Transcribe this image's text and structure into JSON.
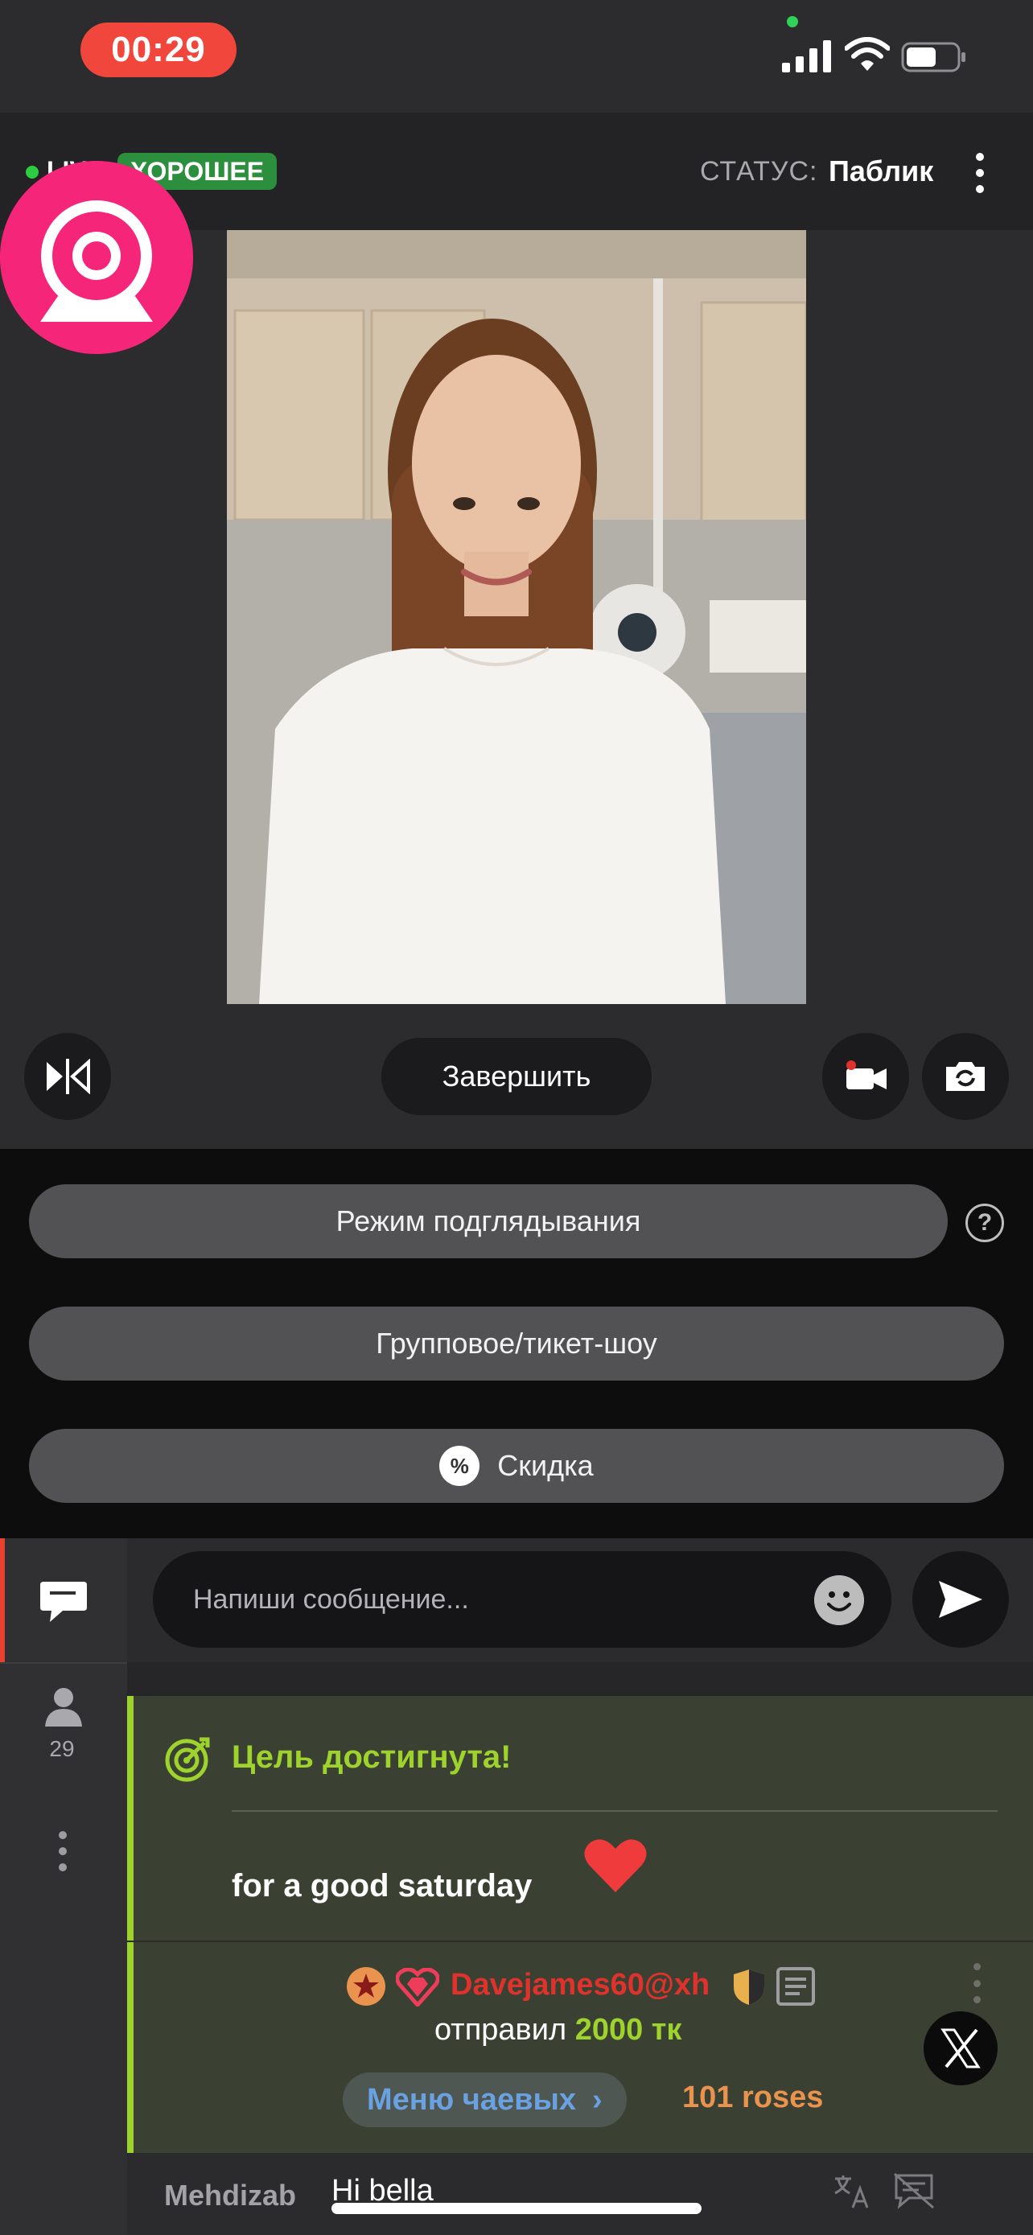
{
  "status_bar": {
    "time": "00:29"
  },
  "header": {
    "live_label": "LIVE",
    "quality_badge": "ХОРОШЕЕ",
    "status_label": "СТАТУС:",
    "status_value": "Паблик"
  },
  "controls": {
    "end_button": "Завершить"
  },
  "options": {
    "peek_mode": "Режим подглядывания",
    "group_show": "Групповое/тикет-шоу",
    "discount": "Скидка",
    "help": "?"
  },
  "chat": {
    "users_count": "29",
    "input_placeholder": "Напиши сообщение...",
    "goal": {
      "title": "Цель достигнута!",
      "text": "for a good saturday"
    },
    "tip": {
      "username": "Davejames60@xh",
      "sent_prefix": "отправил",
      "amount": "2000 тк",
      "menu_button": "Меню чаевых",
      "item": "101 roses"
    },
    "message": {
      "username": "Mehdizab",
      "text": "Hi bella"
    }
  },
  "colors": {
    "accent_green": "#9ed22c",
    "badge_green": "#2c8f3e",
    "live_red": "#f0463b",
    "brand_pink": "#f5257a",
    "username_red": "#e0322c",
    "tip_item_orange": "#e9934e",
    "link_blue": "#6aa1e0"
  }
}
